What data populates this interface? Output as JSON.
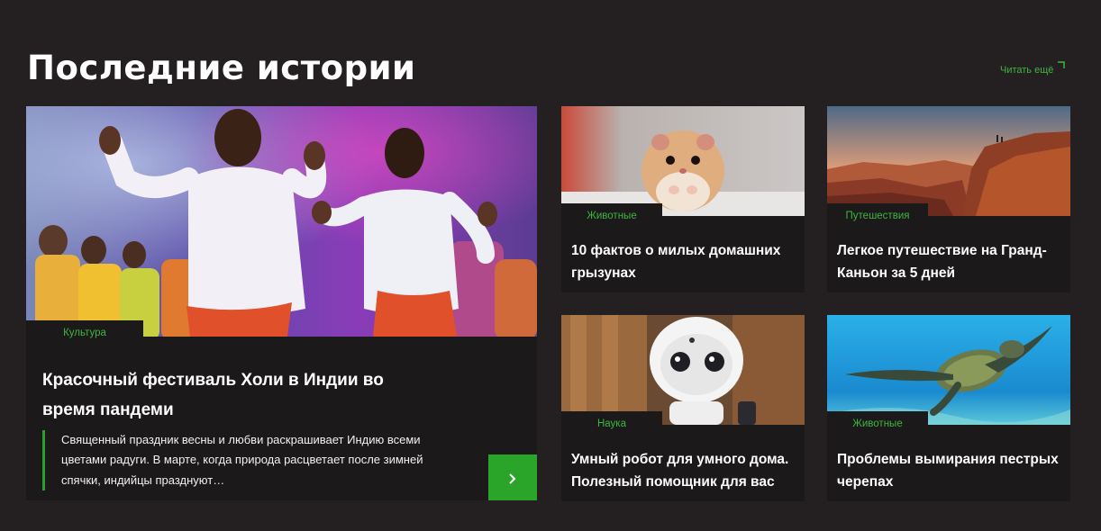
{
  "section": {
    "title": "Последние истории",
    "read_more": "Читать ещё"
  },
  "featured": {
    "category": "Культура",
    "title": "Красочный фестиваль Холи в Индии во время пандеми",
    "excerpt": "Священный праздник весны и любви раскрашивает Индию всеми цветами радуги. В марте, когда природа расцветает после зимней спячки, индийцы празднуют…",
    "button_icon": "chevron-right-icon"
  },
  "cards": [
    {
      "category": "Животные",
      "title": "10 фактов о милых домашних грызунах",
      "image": "hamster"
    },
    {
      "category": "Путешествия",
      "title": "Легкое путешествие на Гранд-Каньон за 5 дней",
      "image": "canyon"
    },
    {
      "category": "Наука",
      "title": "Умный робот для умного дома. Полезный помощник для вас",
      "image": "robot"
    },
    {
      "category": "Животные",
      "title": "Проблемы вымирания пестрых черепах",
      "image": "turtle"
    }
  ],
  "colors": {
    "background": "#242021",
    "card": "#1c191a",
    "accent": "#2aa52a",
    "accent_text": "#3eb63e"
  }
}
